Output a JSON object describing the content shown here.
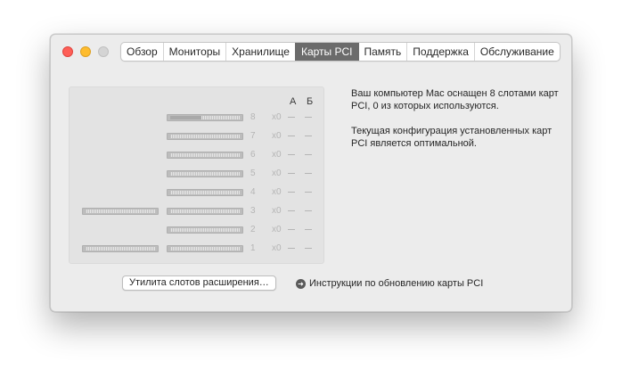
{
  "window": {
    "tabs": [
      {
        "label": "Обзор",
        "active": false
      },
      {
        "label": "Мониторы",
        "active": false
      },
      {
        "label": "Хранилище",
        "active": false
      },
      {
        "label": "Карты PCI",
        "active": true
      },
      {
        "label": "Память",
        "active": false
      },
      {
        "label": "Поддержка",
        "active": false
      },
      {
        "label": "Обслуживание",
        "active": false
      }
    ]
  },
  "pci": {
    "columns": {
      "a": "А",
      "b": "Б"
    },
    "slots": [
      {
        "num": "8",
        "x": "x0",
        "a": "—",
        "b": "—",
        "fill": 0.45,
        "extra": false
      },
      {
        "num": "7",
        "x": "x0",
        "a": "—",
        "b": "—",
        "fill": 0,
        "extra": false
      },
      {
        "num": "6",
        "x": "x0",
        "a": "—",
        "b": "—",
        "fill": 0,
        "extra": false
      },
      {
        "num": "5",
        "x": "x0",
        "a": "—",
        "b": "—",
        "fill": 0,
        "extra": false
      },
      {
        "num": "4",
        "x": "x0",
        "a": "—",
        "b": "—",
        "fill": 0,
        "extra": false
      },
      {
        "num": "3",
        "x": "x0",
        "a": "—",
        "b": "—",
        "fill": 0,
        "extra": true
      },
      {
        "num": "2",
        "x": "x0",
        "a": "—",
        "b": "—",
        "fill": 0,
        "extra": false
      },
      {
        "num": "1",
        "x": "x0",
        "a": "—",
        "b": "—",
        "fill": 0,
        "extra": true
      }
    ]
  },
  "info": {
    "line1": "Ваш компьютер Mac оснащен 8 слотами карт PCI, 0 из которых используются.",
    "line2": "Текущая конфигурация установленных карт PCI является оптимальной."
  },
  "actions": {
    "utility_label": "Утилита слотов расширения…",
    "help_label": "Инструкции по обновлению карты PCI",
    "help_icon": "arrow-right-circle-icon"
  }
}
